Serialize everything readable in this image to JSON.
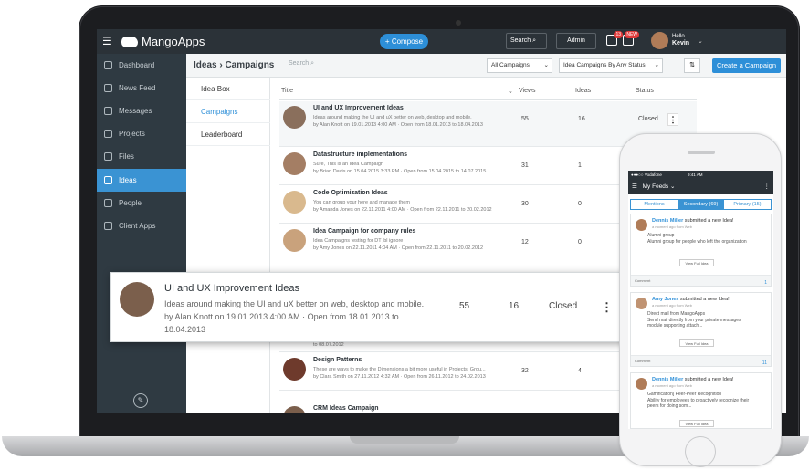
{
  "app": {
    "name": "MangoApps"
  },
  "topbar": {
    "compose_label": "+ Compose",
    "search_label": "Search",
    "admin_label": "Admin",
    "chat_badge": "13",
    "notif_badge": "NEW",
    "hello": "Hello",
    "user_name": "Kevin"
  },
  "sidebar": {
    "items": [
      {
        "label": "Dashboard",
        "icon": "dashboard-icon"
      },
      {
        "label": "News Feed",
        "icon": "newsfeed-icon"
      },
      {
        "label": "Messages",
        "icon": "messages-icon"
      },
      {
        "label": "Projects",
        "icon": "projects-icon"
      },
      {
        "label": "Files",
        "icon": "files-icon"
      },
      {
        "label": "Ideas",
        "icon": "ideas-icon"
      },
      {
        "label": "People",
        "icon": "people-icon"
      },
      {
        "label": "Client Apps",
        "icon": "client-apps-icon"
      }
    ],
    "active": "Ideas"
  },
  "header": {
    "breadcrumb": "Ideas › Campaigns",
    "search_placeholder": "Search",
    "filter1": "All Campaigns",
    "filter2": "Idea Campaigns By Any Status",
    "create_label": "Create a Campaign"
  },
  "submenu": {
    "items": [
      "Idea Box",
      "Campaigns",
      "Leaderboard"
    ],
    "active": "Campaigns"
  },
  "table": {
    "columns": [
      "Title",
      "Views",
      "Ideas",
      "Status"
    ],
    "rows": [
      {
        "title": "UI and UX  Improvement Ideas",
        "desc": "Ideas around making the UI and uX better on web, desktop and mobile.",
        "meta": "by Alan Knott on 19.01.2013 4:00 AM · Open from 18.01.2013 to 18.04.2013",
        "views": "55",
        "ideas": "16",
        "status": "Closed"
      },
      {
        "title": "Datastructure implementations",
        "desc": "Sure, This is an Idea Campaign",
        "meta": "by Brian Davis on 15.04.2015 3:33 PM · Open from 15.04.2015 to 14.07.2015",
        "views": "31",
        "ideas": "1",
        "status": ""
      },
      {
        "title": "Code Optimization Ideas",
        "desc": "You can group your here and manage them",
        "meta": "by Amanda Jones on 22.11.2011 4:00 AM · Open from 22.11.2011 to 20.02.2012",
        "views": "30",
        "ideas": "0",
        "status": ""
      },
      {
        "title": "Idea Campaign for company rules",
        "desc": "Idea Campaigns testing for DT jbl ignore",
        "meta": "by Amy Jones on 22.11.2011 4:04 AM · Open from 22.11.2011 to 20.02.2012",
        "views": "12",
        "ideas": "0",
        "status": ""
      },
      {
        "title": "",
        "desc": "",
        "meta": "to 08.07.2012",
        "views": "",
        "ideas": "",
        "status": ""
      },
      {
        "title": "Design Patterns",
        "desc": "These are ways to make the Dimensions a bit more useful in Projects, Grou...",
        "meta": "by Clara Smith on 27.11.2012 4:32 AM · Open from 26.11.2012 to 24.02.2013",
        "views": "32",
        "ideas": "4",
        "status": ""
      },
      {
        "title": "CRM Ideas Campaign",
        "desc": "",
        "meta": "",
        "views": "",
        "ideas": "",
        "status": ""
      }
    ]
  },
  "popout": {
    "title": "UI and UX  Improvement Ideas",
    "desc": "Ideas around making the UI and uX better on web, desktop and mobile.",
    "meta": "by Alan Knott on 19.01.2013 4:00 AM · Open from 18.01.2013 to 18.04.2013",
    "views": "55",
    "ideas": "16",
    "status": "Closed"
  },
  "phone": {
    "status_left": "●●●○○ Vodafone",
    "status_time": "9:41 AM",
    "title": "My Feeds",
    "tabs": [
      "Mentions",
      "Secondary (69)",
      "Primary (15)"
    ],
    "active_tab": "Secondary (69)",
    "feeds": [
      {
        "name": "Dennis Miller",
        "action": "submitted a new Idea!",
        "time": "a moment ago from Web",
        "body": "Alumni group\nAlumni group for people who left the organization",
        "button": "View Full Idea",
        "footer": "Comment",
        "likes": "1"
      },
      {
        "name": "Amy Jones",
        "action": "submitted a new Idea!",
        "time": "a moment ago from Web",
        "body": "Direct mail from MangoApps\nSend mail directly from your private messages module supporting attach...",
        "button": "View Full Idea",
        "footer": "Comment",
        "likes": "11"
      },
      {
        "name": "Dennis Miller",
        "action": "submitted a new Idea!",
        "time": "a moment ago from Web",
        "body": "Gamification] Peer-Peer Recognition\nAbility for employees to proactively recognize their peers for doing som...",
        "button": "View Full Idea",
        "footer": "",
        "likes": ""
      }
    ]
  },
  "colors": {
    "accent": "#2d8fd8",
    "topbar": "#2b3238",
    "sidebar": "#2f3a42"
  }
}
